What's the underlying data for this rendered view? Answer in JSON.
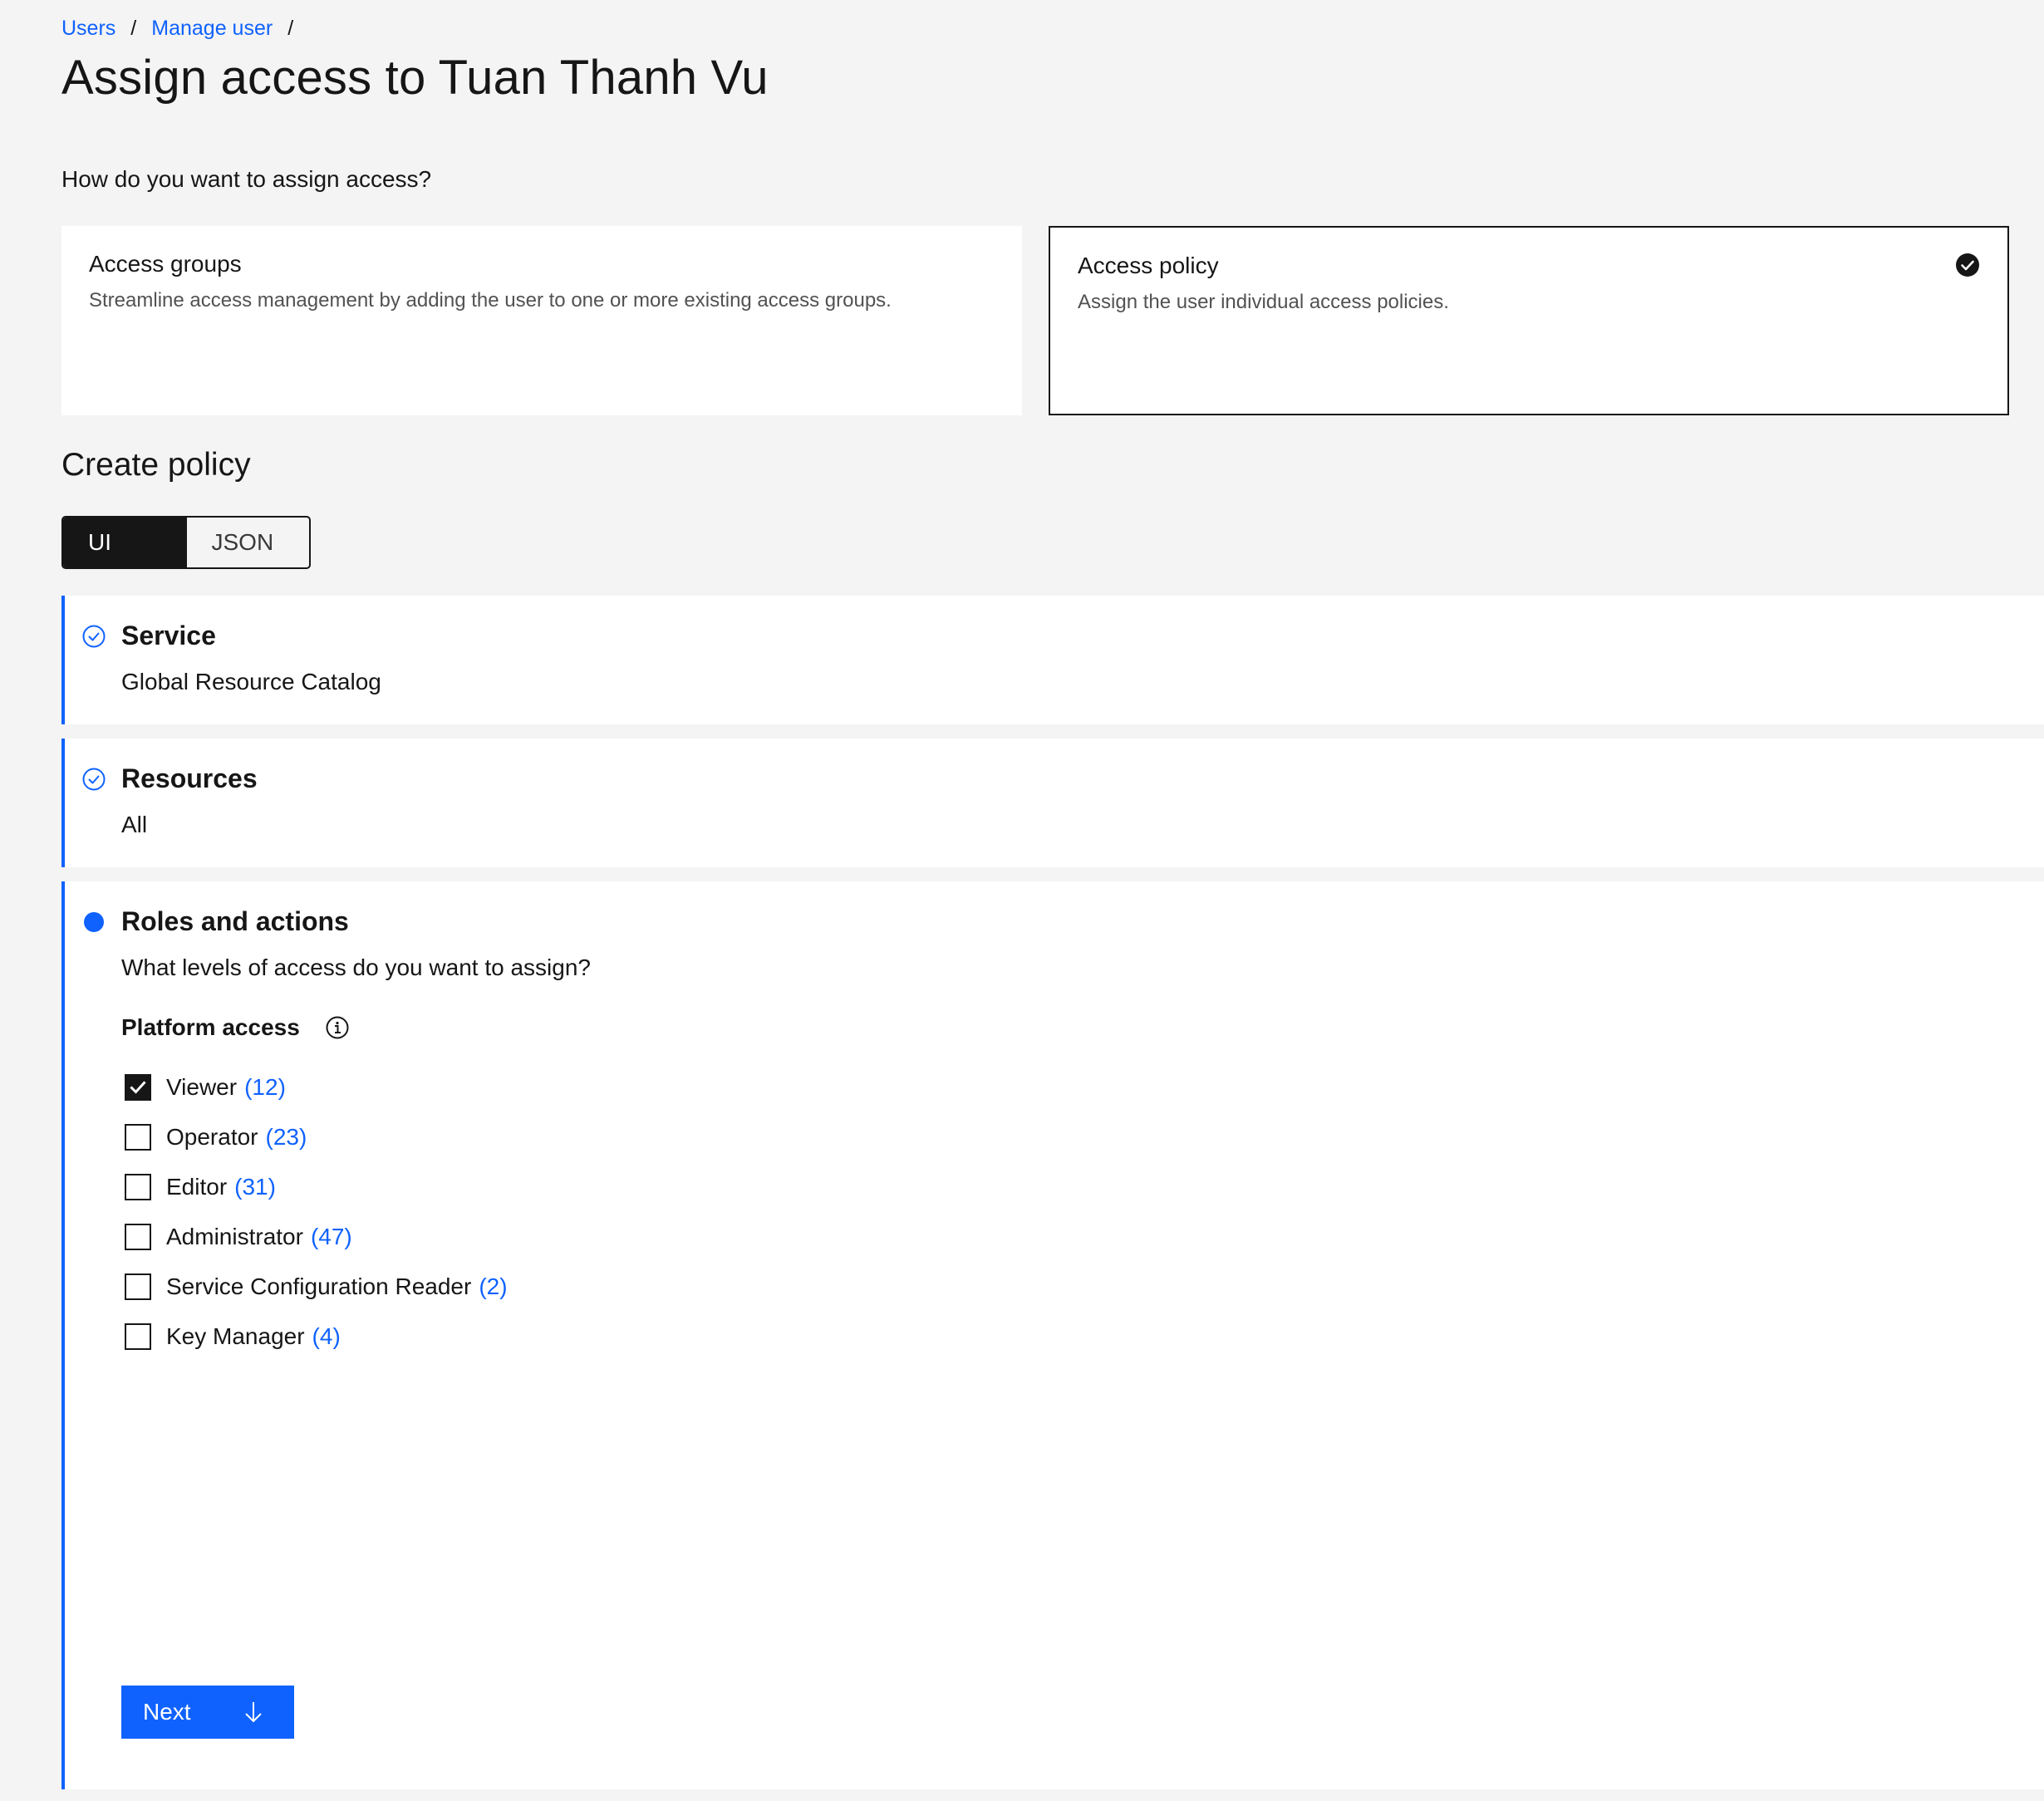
{
  "breadcrumb": {
    "items": [
      "Users",
      "Manage user"
    ],
    "separator": "/"
  },
  "page": {
    "title": "Assign access to Tuan Thanh Vu",
    "question": "How do you want to assign access?"
  },
  "tiles": [
    {
      "title": "Access groups",
      "description": "Streamline access management by adding the user to one or more existing access groups.",
      "selected": false
    },
    {
      "title": "Access policy",
      "description": "Assign the user individual access policies.",
      "selected": true
    }
  ],
  "create_policy": {
    "title": "Create policy",
    "toggle": [
      "UI",
      "JSON"
    ],
    "active_toggle": "UI"
  },
  "steps": {
    "service": {
      "title": "Service",
      "value": "Global Resource Catalog",
      "status": "complete"
    },
    "resources": {
      "title": "Resources",
      "value": "All",
      "status": "complete"
    },
    "roles": {
      "title": "Roles and actions",
      "question": "What levels of access do you want to assign?",
      "status": "current",
      "platform_access_label": "Platform access",
      "roles": [
        {
          "name": "Viewer",
          "count": "(12)",
          "checked": true
        },
        {
          "name": "Operator",
          "count": "(23)",
          "checked": false
        },
        {
          "name": "Editor",
          "count": "(31)",
          "checked": false
        },
        {
          "name": "Administrator",
          "count": "(47)",
          "checked": false
        },
        {
          "name": "Service Configuration Reader",
          "count": "(2)",
          "checked": false
        },
        {
          "name": "Key Manager",
          "count": "(4)",
          "checked": false
        }
      ],
      "next_label": "Next"
    }
  },
  "colors": {
    "accent": "#0f62fe",
    "text": "#161616",
    "background": "#f4f4f4",
    "surface": "#ffffff"
  },
  "icons": {
    "selected_tile": "checkmark-filled-icon",
    "step_complete": "checkmark-outline-icon",
    "step_current": "circle-filled-icon",
    "info": "information-icon",
    "next": "arrow-down-icon"
  }
}
